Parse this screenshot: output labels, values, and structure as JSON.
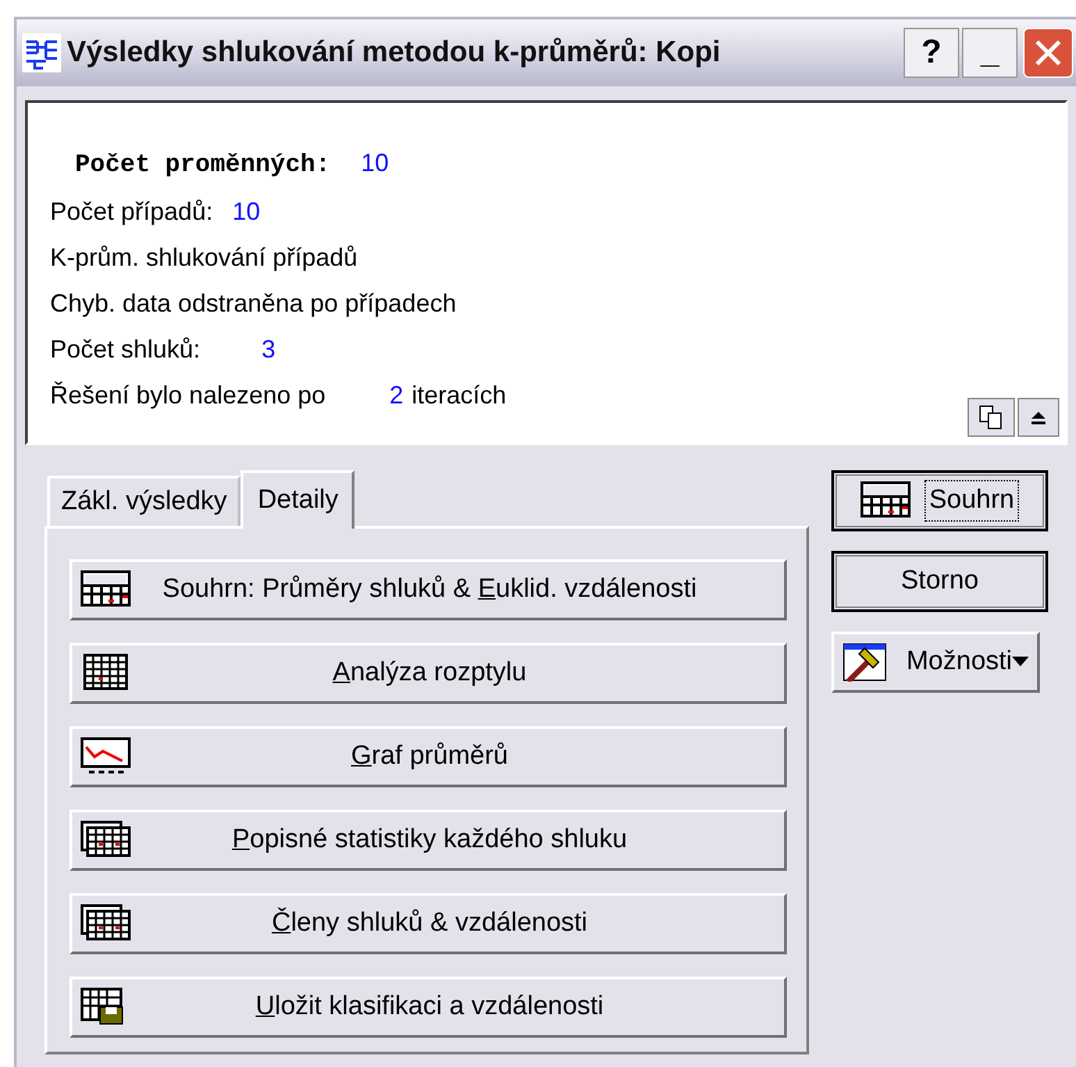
{
  "window": {
    "title": "Výsledky shlukování metodou k-průměrů: Kopi",
    "controls": [
      "?",
      "_"
    ]
  },
  "output": [
    {
      "kind": "mono",
      "label": "Počet proměnných:",
      "value": "10"
    },
    {
      "kind": "pair",
      "label": "Počet případů:",
      "value": "10"
    },
    {
      "kind": "plain",
      "label": "K-prům. shlukování případů"
    },
    {
      "kind": "plain",
      "label": "Chyb. data odstraněna po případech"
    },
    {
      "kind": "pair",
      "label": "Počet shluků:",
      "value": "3"
    },
    {
      "kind": "pair",
      "label": "Řešení bylo nalezeno po",
      "value": "2",
      "after": "iteracích"
    }
  ],
  "tabs": [
    {
      "label": "Zákl. výsledky",
      "selected": false
    },
    {
      "label": "Detaily",
      "selected": true
    }
  ],
  "actions": [
    {
      "pre": "Souhrn: Průměry shluků & ",
      "key": "E",
      "post": "uklid. vzdálenosti"
    },
    {
      "key": "A",
      "post": "nalýza rozptylu"
    },
    {
      "key": "G",
      "post": "raf průměrů"
    },
    {
      "key": "P",
      "post": "opisné statistiky každého shluku"
    },
    {
      "key": "Č",
      "post": "leny shluků & vzdálenosti"
    },
    {
      "key": "U",
      "post": "ložit klasifikaci a vzdálenosti"
    }
  ],
  "side_buttons": [
    {
      "label": "Souhrn",
      "focused": true
    },
    {
      "label": "Storno",
      "focused": false
    },
    {
      "label": "Možnosti",
      "focused": false,
      "dropdown": true
    }
  ]
}
